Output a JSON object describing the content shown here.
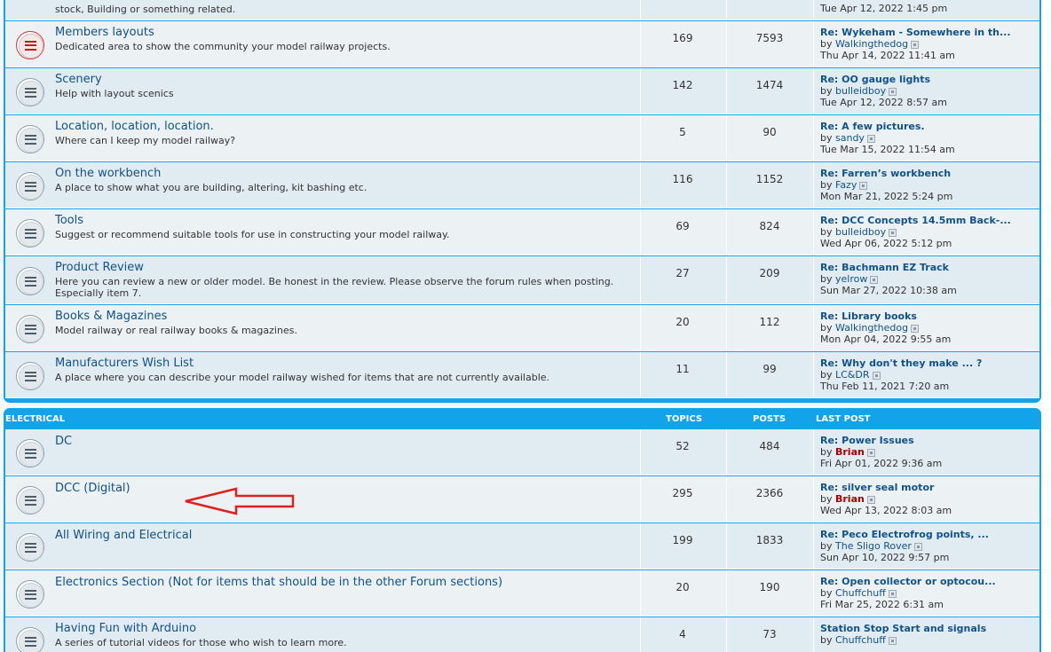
{
  "top_partial": {
    "desc": "stock, Building or something related.",
    "last_date": "Tue Apr 12, 2022 1:45 pm"
  },
  "section_top": {
    "forums": [
      {
        "title": "Members layouts",
        "desc": "Dedicated area to show the community your model railway projects.",
        "topics": "169",
        "posts": "7593",
        "last_title": "Re: Wykeham - Somewhere in th...",
        "last_by": "by",
        "last_user": "Walkingthedog",
        "last_date": "Thu Apr 14, 2022 11:41 am"
      },
      {
        "title": "Scenery",
        "desc": "Help with layout scenics",
        "topics": "142",
        "posts": "1474",
        "last_title": "Re: OO gauge lights",
        "last_by": "by",
        "last_user": "bulleidboy",
        "last_date": "Tue Apr 12, 2022 8:57 am"
      },
      {
        "title": "Location, location, location.",
        "desc": "Where can I keep my model railway?",
        "topics": "5",
        "posts": "90",
        "last_title": "Re: A few pictures.",
        "last_by": "by",
        "last_user": "sandy",
        "last_date": "Tue Mar 15, 2022 11:54 am"
      },
      {
        "title": "On the workbench",
        "desc": "A place to show what you are building, altering, kit bashing etc.",
        "topics": "116",
        "posts": "1152",
        "last_title": "Re: Farren’s workbench",
        "last_by": "by",
        "last_user": "Fazy",
        "last_date": "Mon Mar 21, 2022 5:24 pm"
      },
      {
        "title": "Tools",
        "desc": "Suggest or recommend suitable tools for use in constructing your model railway.",
        "topics": "69",
        "posts": "824",
        "last_title": "Re: DCC Concepts 14.5mm Back-...",
        "last_by": "by",
        "last_user": "bulleidboy",
        "last_date": "Wed Apr 06, 2022 5:12 pm"
      },
      {
        "title": "Product Review",
        "desc": "Here you can review a new or older model. Be honest in the review. Please observe the forum rules when posting. Especially item 7.",
        "topics": "27",
        "posts": "209",
        "last_title": "Re: Bachmann EZ Track",
        "last_by": "by",
        "last_user": "yelrow",
        "last_date": "Sun Mar 27, 2022 10:38 am"
      },
      {
        "title": "Books & Magazines",
        "desc": "Model railway or real railway books & magazines.",
        "topics": "20",
        "posts": "112",
        "last_title": "Re: Library books",
        "last_by": "by",
        "last_user": "Walkingthedog",
        "last_date": "Mon Apr 04, 2022 9:55 am"
      },
      {
        "title": "Manufacturers Wish List",
        "desc": "A place where you can describe your model railway wished for items that are not currently available.",
        "topics": "11",
        "posts": "99",
        "last_title": "Re: Why don't they make ... ?",
        "last_by": "by",
        "last_user": "LC&DR",
        "last_date": "Thu Feb 11, 2021 7:20 am"
      }
    ]
  },
  "section_electrical": {
    "header": {
      "name": "ELECTRICAL",
      "topics": "TOPICS",
      "posts": "POSTS",
      "last_post": "LAST POST"
    },
    "forums": [
      {
        "title": "DC",
        "desc": "",
        "topics": "52",
        "posts": "484",
        "last_title": "Re: Power Issues",
        "last_by": "by",
        "last_user": "Brian",
        "last_date": "Fri Apr 01, 2022 9:36 am"
      },
      {
        "title": "DCC (Digital)",
        "desc": "",
        "topics": "295",
        "posts": "2366",
        "last_title": "Re: silver seal motor",
        "last_by": "by",
        "last_user": "Brian",
        "last_date": "Wed Apr 13, 2022 8:03 am"
      },
      {
        "title": "All Wiring and Electrical",
        "desc": "",
        "topics": "199",
        "posts": "1833",
        "last_title": "Re: Peco Electrofrog points, ...",
        "last_by": "by",
        "last_user": "The Sligo Rover",
        "last_date": "Sun Apr 10, 2022 9:57 pm"
      },
      {
        "title": "Electronics Section (Not for items that should be in the other Forum sections)",
        "desc": "",
        "topics": "20",
        "posts": "190",
        "last_title": "Re: Open collector or optocou...",
        "last_by": "by",
        "last_user": "Chuffchuff",
        "last_date": "Fri Mar 25, 2022 6:31 am"
      },
      {
        "title": "Having Fun with Arduino",
        "desc": "A series of tutorial videos for those who wish to learn more.",
        "topics": "4",
        "posts": "73",
        "last_title": "Station Stop Start and signals",
        "last_by": "by",
        "last_user": "Chuffchuff",
        "last_date": ""
      }
    ]
  },
  "colors": {
    "accent": "#12a3eb",
    "link": "#105289",
    "admin_user": "#aa0000",
    "annotation_arrow": "#e02020"
  }
}
